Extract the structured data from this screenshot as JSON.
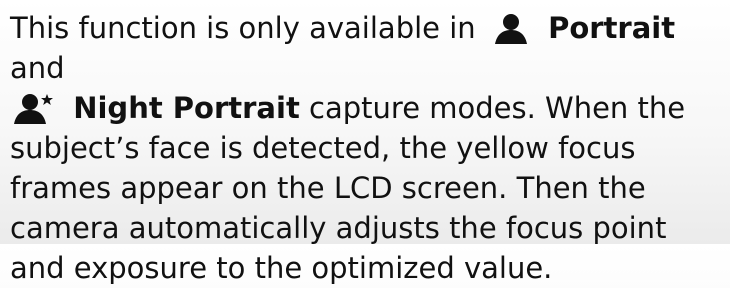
{
  "paragraph": {
    "part1": "This function is only available in ",
    "mode1": "Portrait",
    "and": " and",
    "mode2": "Night Portrait",
    "part2": " capture modes. When the subject’s face is detected, the yellow focus frames appear on the LCD screen. Then the camera automatically adjusts the focus point and exposure to the optimized value."
  },
  "icons": {
    "portrait": "portrait-icon",
    "night_portrait": "night-portrait-icon"
  }
}
